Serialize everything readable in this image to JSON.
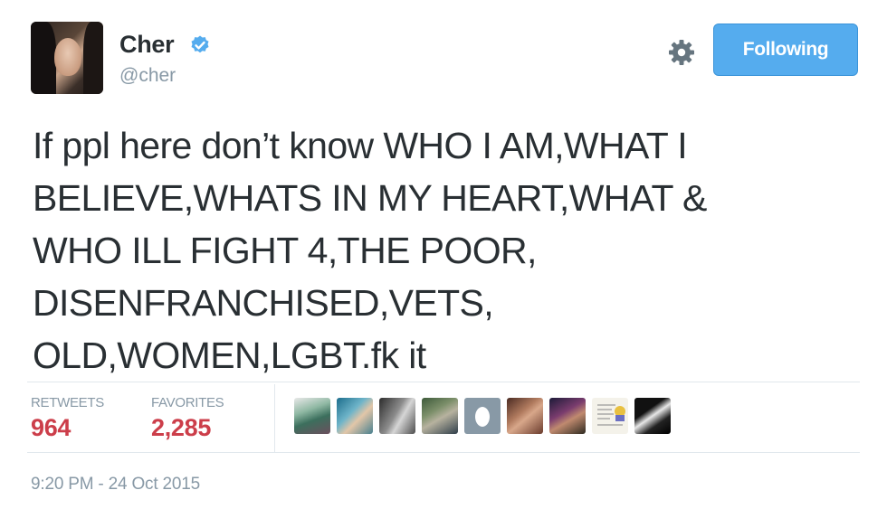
{
  "user": {
    "display_name": "Cher",
    "handle": "@cher",
    "verified": true,
    "avatar_icon": "profile-photo"
  },
  "actions": {
    "settings_icon": "gear-icon",
    "follow_label": "Following"
  },
  "tweet": {
    "lines": [
      "If ppl here don’t know WHO I AM,WHAT I",
      "BELIEVE,WHATS IN MY HEART,WHAT &",
      "WHO ILL FIGHT 4,THE POOR,",
      "DISENFRANCHISED,VETS,",
      "OLD,WOMEN,LGBT.fk it"
    ]
  },
  "stats": {
    "retweets_label": "RETWEETS",
    "retweets_value": "964",
    "favorites_label": "FAVORITES",
    "favorites_value": "2,285"
  },
  "favorited_by": [
    {
      "icon": "user-avatar-1"
    },
    {
      "icon": "user-avatar-2"
    },
    {
      "icon": "user-avatar-3"
    },
    {
      "icon": "user-avatar-4"
    },
    {
      "icon": "user-avatar-5-default-egg"
    },
    {
      "icon": "user-avatar-6"
    },
    {
      "icon": "user-avatar-7"
    },
    {
      "icon": "user-avatar-8"
    },
    {
      "icon": "user-avatar-9"
    }
  ],
  "timestamp": "9:20 PM - 24 Oct 2015",
  "colors": {
    "follow_button": "#55acee",
    "stat_value": "#cc3e4a",
    "muted_text": "#8899a6",
    "verified_badge": "#55acee"
  }
}
